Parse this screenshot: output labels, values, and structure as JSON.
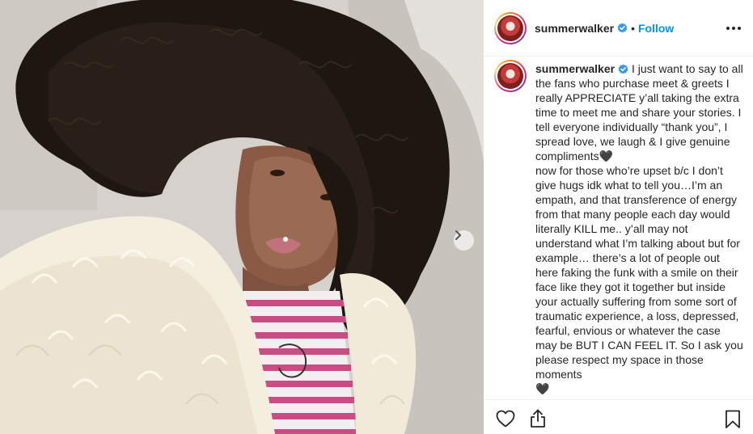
{
  "post": {
    "username": "summerwalker",
    "follow_label": "Follow",
    "dot_separator": "•",
    "caption_user": "summerwalker",
    "caption_body": "I just want to say to all the fans who purchase meet & greets I really APPRECIATE y’all taking the extra time to meet me and share your stories. I tell everyone individually “thank you”, I spread love, we laugh & I give genuine compliments🖤\nnow for those who’re upset b/c I don’t give hugs idk what to tell you…I’m an empath, and that transference of energy from that many people each day would literally KILL me.. y’all may not understand what I’m talking about but for example… there’s a lot of people out here faking the funk with a smile on their face like they got it together but inside your actually suffering from some sort of traumatic experience, a loss, depressed, fearful, envious or whatever the case may be BUT I CAN FEEL IT. So I ask you please respect my space in those moments\n🖤"
  },
  "icons": {
    "verified": "verified-badge-icon",
    "more": "more-options-icon",
    "next": "chevron-right-icon",
    "like": "heart-icon",
    "share": "share-icon",
    "save": "bookmark-icon"
  },
  "colors": {
    "follow_blue": "#0095f6",
    "verified_blue": "#3897f0",
    "text": "#262626",
    "divider": "#efefef"
  }
}
